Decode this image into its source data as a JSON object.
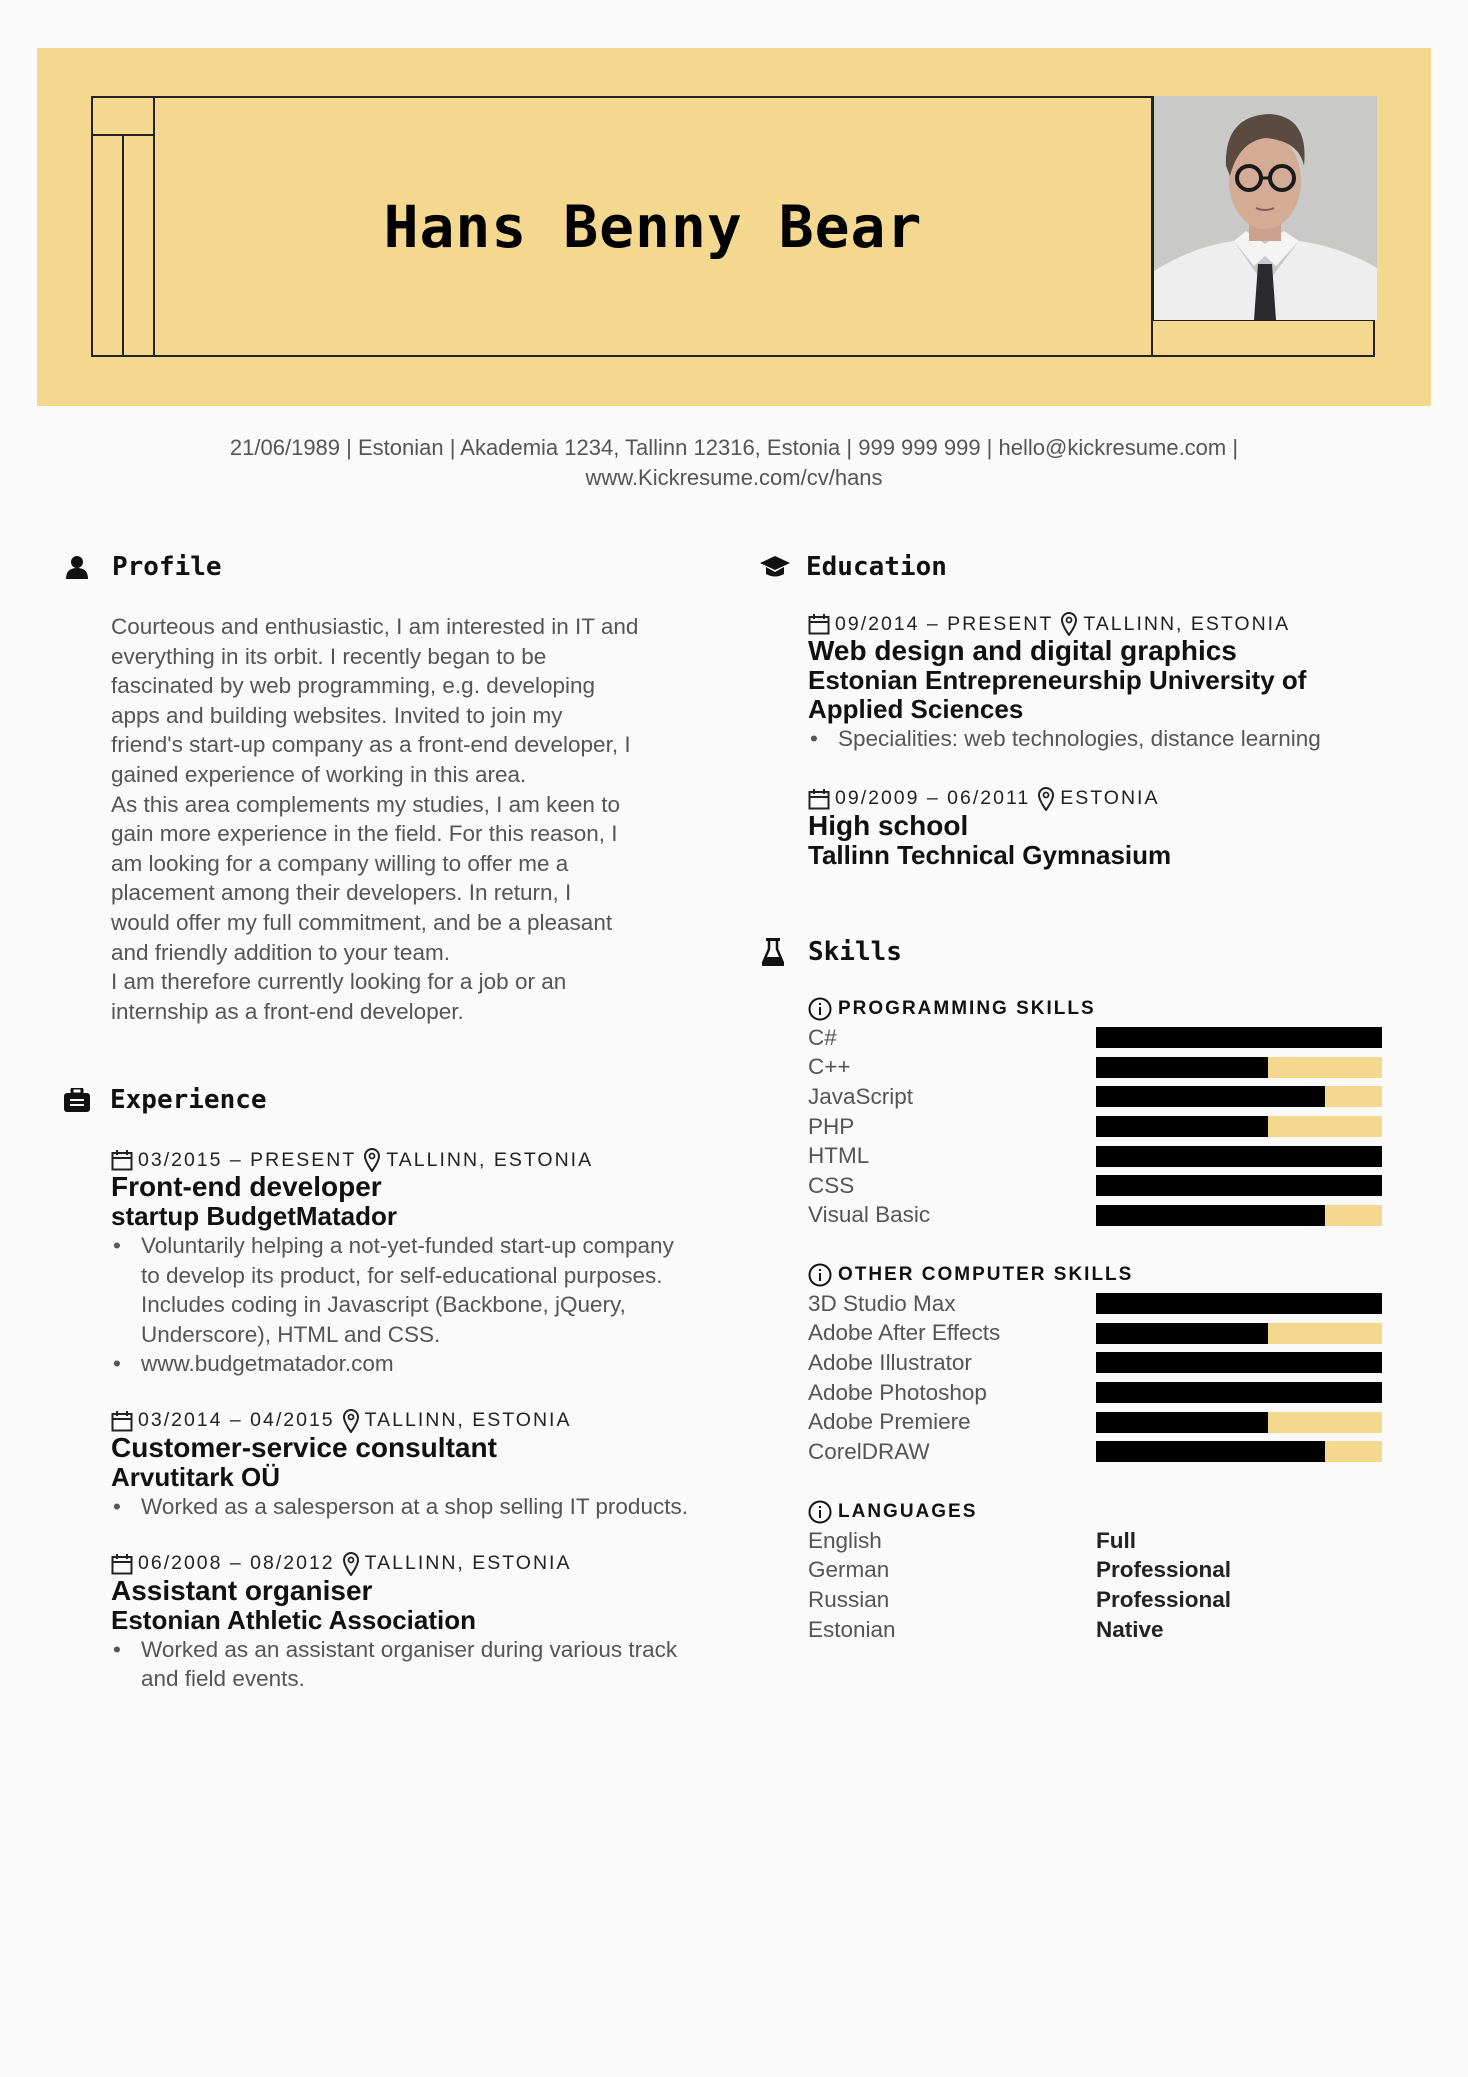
{
  "header": {
    "name": "Hans Benny Bear",
    "photo_alt": "profile-photo",
    "accent_color": "#f5d890"
  },
  "contact": {
    "line1": "21/06/1989  |  Estonian  |  Akademia 1234, Tallinn 12316, Estonia  |  999 999 999  |  hello@kickresume.com  |",
    "line2": "www.Kickresume.com/cv/hans"
  },
  "profile": {
    "heading": "Profile",
    "icon": "user-icon",
    "lines": [
      "Courteous and enthusiastic, I am interested in IT and",
      "everything in its orbit. I recently began to be",
      "fascinated by web programming, e.g. developing",
      "apps and building websites. Invited to join my",
      "friend's start-up company as a front-end developer, I",
      "gained experience of working in this area.",
      "As this area complements my studies, I am keen to",
      "gain more experience in the field. For this reason, I",
      "am looking for a company willing to offer me a",
      "placement among their developers. In return, I",
      "would offer my full commitment, and be a pleasant",
      "and friendly addition to your team.",
      "I am therefore currently looking for a job or an",
      "internship as a front-end developer."
    ]
  },
  "experience": {
    "heading": "Experience",
    "icon": "briefcase-icon",
    "items": [
      {
        "dates": "03/2015 – PRESENT",
        "location": "TALLINN, ESTONIA",
        "title": "Front-end developer",
        "org": "startup BudgetMatador",
        "bullets": [
          "Voluntarily helping a not-yet-funded start-up company to develop its product, for self-educational purposes. Includes coding in Javascript (Backbone, jQuery, Underscore), HTML and CSS.",
          "www.budgetmatador.com"
        ]
      },
      {
        "dates": "03/2014 – 04/2015",
        "location": "TALLINN, ESTONIA",
        "title": "Customer-service consultant",
        "org": "Arvutitark OÜ",
        "bullets": [
          "Worked as a salesperson at a shop selling IT products."
        ]
      },
      {
        "dates": "06/2008 – 08/2012",
        "location": "TALLINN, ESTONIA",
        "title": "Assistant organiser",
        "org": "Estonian Athletic Association",
        "bullets": [
          "Worked as an assistant organiser during various track and field events."
        ]
      }
    ]
  },
  "education": {
    "heading": "Education",
    "icon": "graduation-cap-icon",
    "items": [
      {
        "dates": "09/2014 – PRESENT",
        "location": "TALLINN, ESTONIA",
        "title": "Web design and digital graphics",
        "org": "Estonian Entrepreneurship University of Applied Sciences",
        "bullets": [
          "Specialities: web technologies, distance learning"
        ]
      },
      {
        "dates": "09/2009 – 06/2011",
        "location": "ESTONIA",
        "title": "High school",
        "org": "Tallinn Technical Gymnasium",
        "bullets": []
      }
    ]
  },
  "skills": {
    "heading": "Skills",
    "icon": "flask-icon",
    "programming": {
      "label": "PROGRAMMING SKILLS",
      "items": [
        {
          "name": "C#",
          "level": 1.0
        },
        {
          "name": "C++",
          "level": 0.6
        },
        {
          "name": "JavaScript",
          "level": 0.8
        },
        {
          "name": "PHP",
          "level": 0.6
        },
        {
          "name": "HTML",
          "level": 1.0
        },
        {
          "name": "CSS",
          "level": 1.0
        },
        {
          "name": "Visual Basic",
          "level": 0.8
        }
      ]
    },
    "other": {
      "label": "OTHER COMPUTER SKILLS",
      "items": [
        {
          "name": "3D Studio Max",
          "level": 1.0
        },
        {
          "name": "Adobe After Effects",
          "level": 0.6
        },
        {
          "name": "Adobe Illustrator",
          "level": 1.0
        },
        {
          "name": "Adobe Photoshop",
          "level": 1.0
        },
        {
          "name": "Adobe Premiere",
          "level": 0.6
        },
        {
          "name": "CorelDRAW",
          "level": 0.8
        }
      ]
    },
    "languages": {
      "label": "LANGUAGES",
      "items": [
        {
          "name": "English",
          "level": "Full"
        },
        {
          "name": "German",
          "level": "Professional"
        },
        {
          "name": "Russian",
          "level": "Professional"
        },
        {
          "name": "Estonian",
          "level": "Native"
        }
      ]
    }
  }
}
